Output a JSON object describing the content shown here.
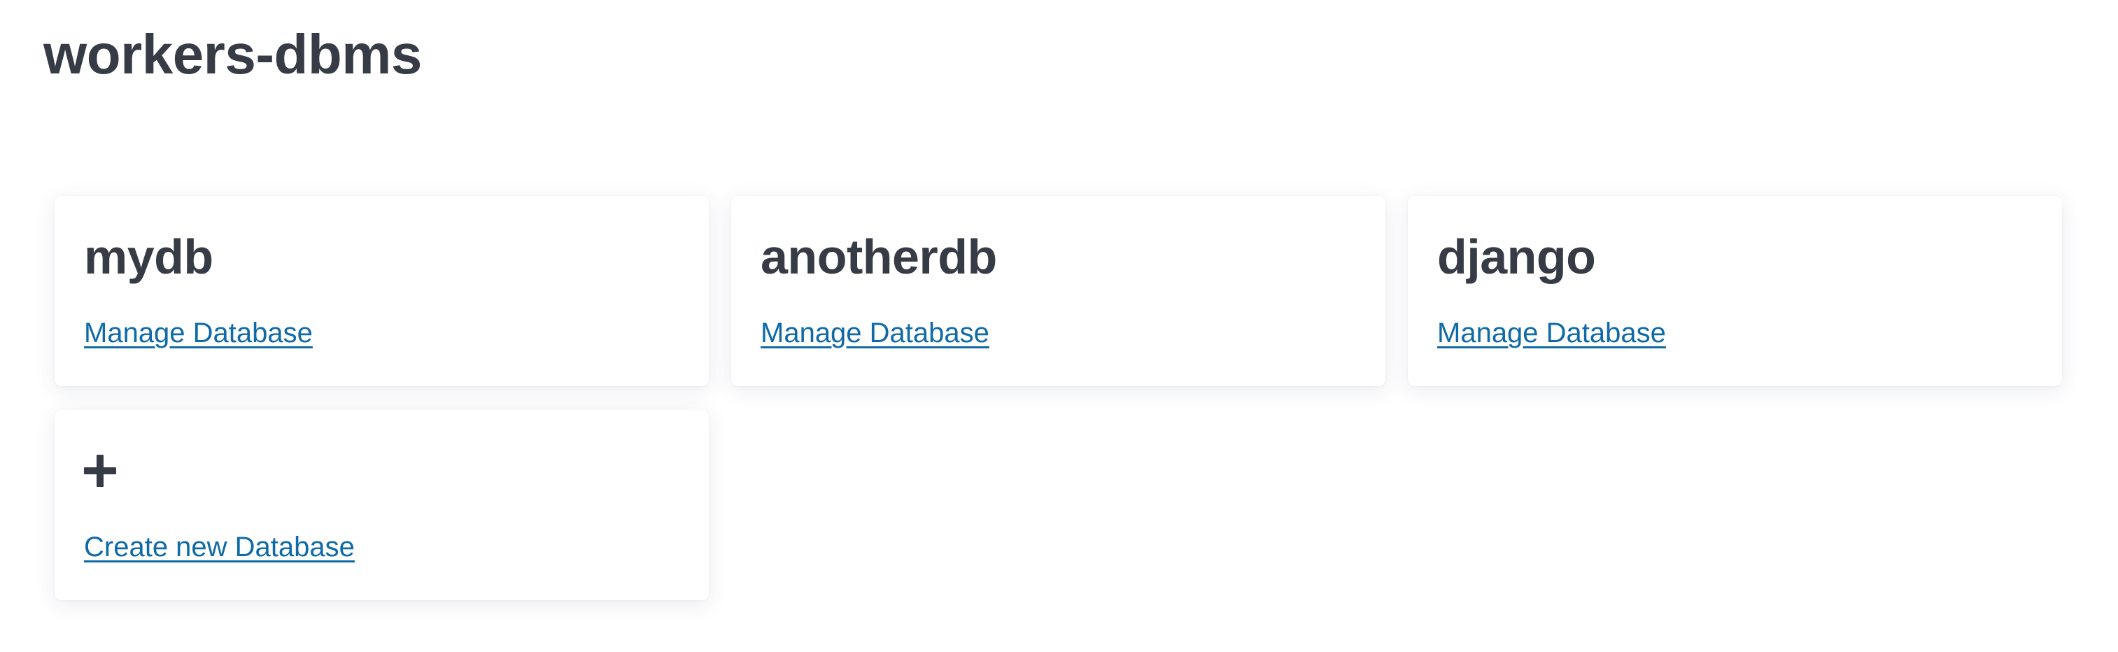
{
  "page": {
    "title": "workers-dbms"
  },
  "databases": [
    {
      "name": "mydb",
      "link_label": "Manage Database"
    },
    {
      "name": "anotherdb",
      "link_label": "Manage Database"
    },
    {
      "name": "django",
      "link_label": "Manage Database"
    }
  ],
  "create_card": {
    "icon": "plus-icon",
    "link_label": "Create new Database"
  },
  "colors": {
    "text": "#363b45",
    "link": "#0f6aa8",
    "background": "#ffffff"
  }
}
